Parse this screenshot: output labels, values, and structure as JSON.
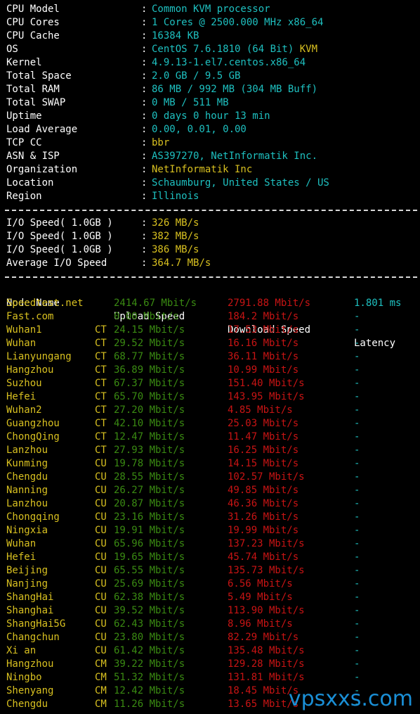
{
  "system_info": [
    {
      "label": "CPU Model",
      "value": "Common KVM processor",
      "color": "cyan"
    },
    {
      "label": "CPU Cores",
      "value": "1 Cores @ 2500.000 MHz x86_64",
      "color": "cyan"
    },
    {
      "label": "CPU Cache",
      "value": "16384 KB",
      "color": "cyan"
    },
    {
      "label": "OS",
      "value": "CentOS 7.6.1810 (64 Bit)",
      "value_suffix": "KVM",
      "color": "cyan"
    },
    {
      "label": "Kernel",
      "value": "4.9.13-1.el7.centos.x86_64",
      "color": "cyan"
    },
    {
      "label": "Total Space",
      "value": "2.0 GB / 9.5 GB",
      "color": "cyan"
    },
    {
      "label": "Total RAM",
      "value": "86 MB / 992 MB (304 MB Buff)",
      "color": "cyan"
    },
    {
      "label": "Total SWAP",
      "value": "0 MB / 511 MB",
      "color": "cyan"
    },
    {
      "label": "Uptime",
      "value": "0 days 0 hour 13 min",
      "color": "cyan"
    },
    {
      "label": "Load Average",
      "value": "0.00, 0.01, 0.00",
      "color": "cyan"
    },
    {
      "label": "TCP CC",
      "value": "bbr",
      "color": "yellow"
    },
    {
      "label": "ASN & ISP",
      "value": "AS397270, NetInformatik Inc.",
      "color": "cyan"
    },
    {
      "label": "Organization",
      "value": "NetInformatik Inc",
      "color": "yellow"
    },
    {
      "label": "Location",
      "value": "Schaumburg, United States / US",
      "color": "cyan"
    },
    {
      "label": "Region",
      "value": "Illinois",
      "color": "cyan"
    }
  ],
  "separator": ":",
  "io_tests": [
    {
      "label": "I/O Speed( 1.0GB )",
      "value": "326 MB/s"
    },
    {
      "label": "I/O Speed( 1.0GB )",
      "value": "382 MB/s"
    },
    {
      "label": "I/O Speed( 1.0GB )",
      "value": "386 MB/s"
    },
    {
      "label": "Average I/O Speed",
      "value": "364.7 MB/s"
    }
  ],
  "speed_table": {
    "headers": {
      "node": "Node Name",
      "upload": "Upload Speed",
      "download": "Download Speed",
      "latency": "Latency"
    },
    "rows": [
      {
        "node": "Speedtest.net",
        "isp": "",
        "upload": "2414.67 Mbit/s",
        "download": "2791.88 Mbit/s",
        "latency": "1.801 ms"
      },
      {
        "node": "Fast.com",
        "isp": "",
        "upload": "0.00 Mbit/s",
        "download": "184.2 Mbit/s",
        "latency": "-"
      },
      {
        "node": "Wuhan1",
        "isp": "CT",
        "upload": "24.15 Mbit/s",
        "download": "17.53 Mbit/s",
        "latency": "-"
      },
      {
        "node": "Wuhan",
        "isp": "CT",
        "upload": "29.52 Mbit/s",
        "download": "16.16 Mbit/s",
        "latency": "-"
      },
      {
        "node": "Lianyungang",
        "isp": "CT",
        "upload": "68.77 Mbit/s",
        "download": "36.11 Mbit/s",
        "latency": "-"
      },
      {
        "node": "Hangzhou",
        "isp": "CT",
        "upload": "36.89 Mbit/s",
        "download": "10.99 Mbit/s",
        "latency": "-"
      },
      {
        "node": "Suzhou",
        "isp": "CT",
        "upload": "67.37 Mbit/s",
        "download": "151.40 Mbit/s",
        "latency": "-"
      },
      {
        "node": "Hefei",
        "isp": "CT",
        "upload": "65.70 Mbit/s",
        "download": "143.95 Mbit/s",
        "latency": "-"
      },
      {
        "node": "Wuhan2",
        "isp": "CT",
        "upload": "27.20 Mbit/s",
        "download": "4.85 Mbit/s",
        "latency": "-"
      },
      {
        "node": "Guangzhou",
        "isp": "CT",
        "upload": "42.10 Mbit/s",
        "download": "25.03 Mbit/s",
        "latency": "-"
      },
      {
        "node": "ChongQing",
        "isp": "CT",
        "upload": "12.47 Mbit/s",
        "download": "11.47 Mbit/s",
        "latency": "-"
      },
      {
        "node": "Lanzhou",
        "isp": "CT",
        "upload": "27.93 Mbit/s",
        "download": "16.25 Mbit/s",
        "latency": "-"
      },
      {
        "node": "Kunming",
        "isp": "CU",
        "upload": "19.78 Mbit/s",
        "download": "14.15 Mbit/s",
        "latency": "-"
      },
      {
        "node": "Chengdu",
        "isp": "CU",
        "upload": "28.55 Mbit/s",
        "download": "102.57 Mbit/s",
        "latency": "-"
      },
      {
        "node": "Nanning",
        "isp": "CU",
        "upload": "26.27 Mbit/s",
        "download": "49.85 Mbit/s",
        "latency": "-"
      },
      {
        "node": "Lanzhou",
        "isp": "CU",
        "upload": "20.87 Mbit/s",
        "download": "46.36 Mbit/s",
        "latency": "-"
      },
      {
        "node": "Chongqing",
        "isp": "CU",
        "upload": "23.16 Mbit/s",
        "download": "31.26 Mbit/s",
        "latency": "-"
      },
      {
        "node": "Ningxia",
        "isp": "CU",
        "upload": "19.91 Mbit/s",
        "download": "19.99 Mbit/s",
        "latency": "-"
      },
      {
        "node": "Wuhan",
        "isp": "CU",
        "upload": "65.96 Mbit/s",
        "download": "137.23 Mbit/s",
        "latency": "-"
      },
      {
        "node": "Hefei",
        "isp": "CU",
        "upload": "19.65 Mbit/s",
        "download": "45.74 Mbit/s",
        "latency": "-"
      },
      {
        "node": "Beijing",
        "isp": "CU",
        "upload": "65.55 Mbit/s",
        "download": "135.73 Mbit/s",
        "latency": "-"
      },
      {
        "node": "Nanjing",
        "isp": "CU",
        "upload": "25.69 Mbit/s",
        "download": "6.56 Mbit/s",
        "latency": "-"
      },
      {
        "node": "ShangHai",
        "isp": "CU",
        "upload": "62.38 Mbit/s",
        "download": "5.49 Mbit/s",
        "latency": "-"
      },
      {
        "node": "Shanghai",
        "isp": "CU",
        "upload": "39.52 Mbit/s",
        "download": "113.90 Mbit/s",
        "latency": "-"
      },
      {
        "node": "ShangHai5G",
        "isp": "CU",
        "upload": "62.43 Mbit/s",
        "download": "8.96 Mbit/s",
        "latency": "-"
      },
      {
        "node": "Changchun",
        "isp": "CU",
        "upload": "23.80 Mbit/s",
        "download": "82.29 Mbit/s",
        "latency": "-"
      },
      {
        "node": "Xi an",
        "isp": "CU",
        "upload": "61.42 Mbit/s",
        "download": "135.48 Mbit/s",
        "latency": "-"
      },
      {
        "node": "Hangzhou",
        "isp": "CM",
        "upload": "39.22 Mbit/s",
        "download": "129.28 Mbit/s",
        "latency": "-"
      },
      {
        "node": "Ningbo",
        "isp": "CM",
        "upload": "51.32 Mbit/s",
        "download": "131.81 Mbit/s",
        "latency": "-"
      },
      {
        "node": "Shenyang",
        "isp": "CM",
        "upload": "12.42 Mbit/s",
        "download": "18.45 Mbit/s",
        "latency": "-"
      },
      {
        "node": "Chengdu",
        "isp": "CM",
        "upload": "11.26 Mbit/s",
        "download": "13.65 Mbit/s",
        "latency": "-"
      }
    ]
  },
  "watermark": "vpsxxs.com",
  "colors": {
    "background": "#000000",
    "label": "#ffffff",
    "cyan": "#1ec0c0",
    "yellow": "#d8c020",
    "green": "#3a8a12",
    "red": "#c81414",
    "watermark": "#1a8fd6"
  }
}
